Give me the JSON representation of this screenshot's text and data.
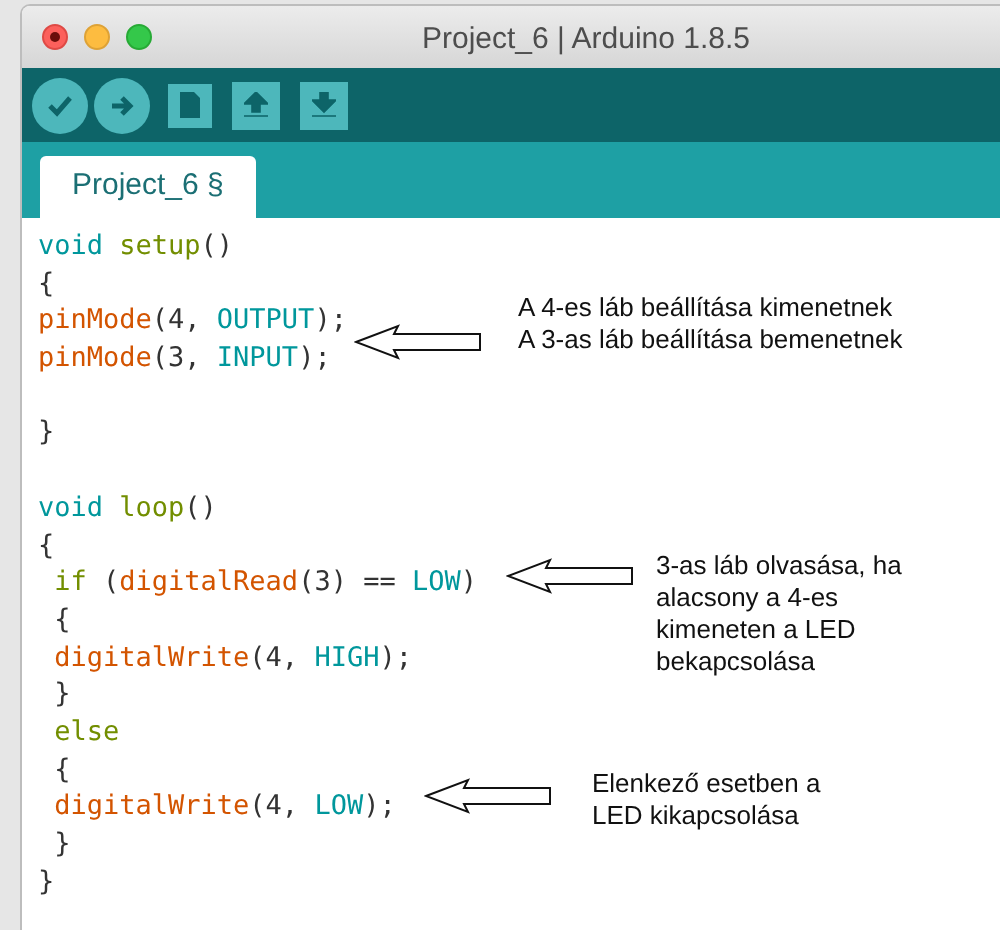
{
  "window": {
    "title": "Project_6 | Arduino 1.8.5"
  },
  "tabs": [
    {
      "label": "Project_6 §",
      "selected": true
    }
  ],
  "code_lines": [
    {
      "kind": "code",
      "indented": false,
      "tokens": [
        {
          "text": "void ",
          "kind": "type"
        },
        {
          "text": "setup",
          "kind": "control"
        },
        {
          "text": "()",
          "kind": "plain"
        }
      ]
    },
    {
      "kind": "code",
      "indented": false,
      "tokens": [
        {
          "text": "{",
          "kind": "plain"
        }
      ]
    },
    {
      "kind": "code",
      "indented": false,
      "tokens": [
        {
          "text": "pinMode",
          "kind": "function"
        },
        {
          "text": "(4, ",
          "kind": "plain"
        },
        {
          "text": "OUTPUT",
          "kind": "constant"
        },
        {
          "text": ");",
          "kind": "plain"
        }
      ]
    },
    {
      "kind": "code",
      "indented": false,
      "tokens": [
        {
          "text": "pinMode",
          "kind": "function"
        },
        {
          "text": "(3, ",
          "kind": "plain"
        },
        {
          "text": "INPUT",
          "kind": "constant"
        },
        {
          "text": ");",
          "kind": "plain"
        }
      ]
    },
    {
      "kind": "blank"
    },
    {
      "kind": "code",
      "indented": false,
      "tokens": [
        {
          "text": "}",
          "kind": "plain"
        }
      ]
    },
    {
      "kind": "blank"
    },
    {
      "kind": "code",
      "indented": false,
      "tokens": [
        {
          "text": "void ",
          "kind": "type"
        },
        {
          "text": "loop",
          "kind": "control"
        },
        {
          "text": "()",
          "kind": "plain"
        }
      ]
    },
    {
      "kind": "code",
      "indented": false,
      "tokens": [
        {
          "text": "{",
          "kind": "plain"
        }
      ]
    },
    {
      "kind": "code",
      "indented": true,
      "tokens": [
        {
          "text": "if ",
          "kind": "control"
        },
        {
          "text": "(",
          "kind": "plain"
        },
        {
          "text": "digitalRead",
          "kind": "function"
        },
        {
          "text": "(3) == ",
          "kind": "plain"
        },
        {
          "text": "LOW",
          "kind": "constant"
        },
        {
          "text": ")",
          "kind": "plain"
        }
      ]
    },
    {
      "kind": "code",
      "indented": true,
      "tokens": [
        {
          "text": "{",
          "kind": "plain"
        }
      ]
    },
    {
      "kind": "code",
      "indented": true,
      "tokens": [
        {
          "text": "digitalWrite",
          "kind": "function"
        },
        {
          "text": "(4, ",
          "kind": "plain"
        },
        {
          "text": "HIGH",
          "kind": "constant"
        },
        {
          "text": ");",
          "kind": "plain"
        }
      ]
    },
    {
      "kind": "code",
      "indented": true,
      "tokens": [
        {
          "text": "}",
          "kind": "plain"
        }
      ]
    },
    {
      "kind": "code",
      "indented": true,
      "tokens": [
        {
          "text": "else",
          "kind": "control"
        }
      ]
    },
    {
      "kind": "code",
      "indented": true,
      "tokens": [
        {
          "text": "{",
          "kind": "plain"
        }
      ]
    },
    {
      "kind": "code",
      "indented": true,
      "tokens": [
        {
          "text": "digitalWrite",
          "kind": "function"
        },
        {
          "text": "(4, ",
          "kind": "plain"
        },
        {
          "text": "LOW",
          "kind": "constant"
        },
        {
          "text": ");",
          "kind": "plain"
        }
      ]
    },
    {
      "kind": "code",
      "indented": true,
      "tokens": [
        {
          "text": "}",
          "kind": "plain"
        }
      ]
    },
    {
      "kind": "code",
      "indented": false,
      "tokens": [
        {
          "text": "}",
          "kind": "plain"
        }
      ]
    }
  ],
  "annotations": [
    {
      "lines": [
        "A 4-es láb beállítása kimenetnek",
        "A 3-as láb beállítása bemenetnek"
      ]
    },
    {
      "lines": [
        "3-as láb olvasása, ha",
        "alacsony a 4-es",
        "kimeneten a LED",
        "bekapcsolása"
      ]
    },
    {
      "lines": [
        "Elenkező esetben a",
        "LED kikapcsolása"
      ]
    }
  ]
}
